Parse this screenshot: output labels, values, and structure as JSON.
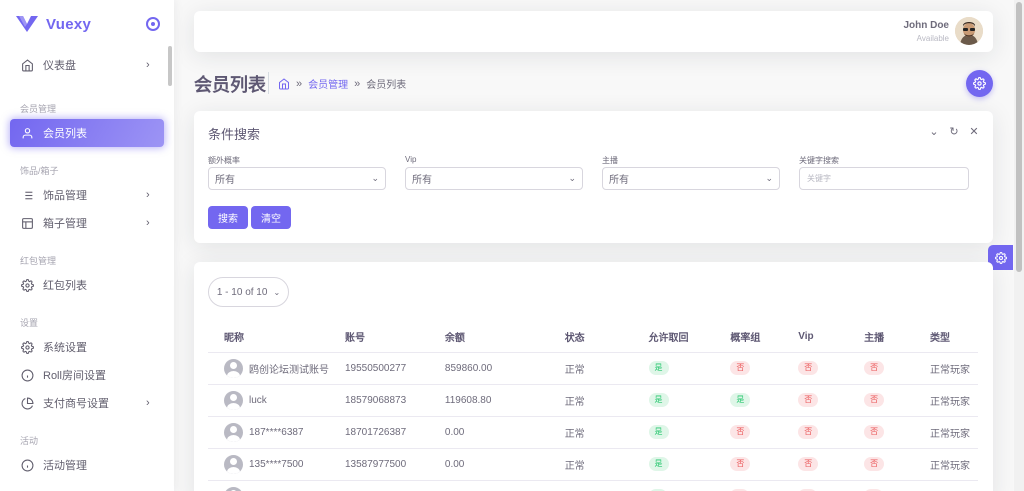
{
  "brand": {
    "name": "Vuexy",
    "color": "#7367f0"
  },
  "sidebar": {
    "dashboard": {
      "label": "仪表盘",
      "icon": "home-icon"
    },
    "sections": [
      {
        "header": "会员管理"
      },
      {
        "header": "饰品/箱子"
      },
      {
        "header": "红包管理"
      },
      {
        "header": "设置"
      },
      {
        "header": "活动"
      }
    ],
    "items": {
      "members": {
        "label": "会员列表",
        "icon": "user-icon",
        "active": true
      },
      "items_mgmt": {
        "label": "饰品管理",
        "icon": "list-icon"
      },
      "box_mgmt": {
        "label": "箱子管理",
        "icon": "layout-icon"
      },
      "redpacket_list": {
        "label": "红包列表",
        "icon": "settings-icon"
      },
      "system_settings": {
        "label": "系统设置",
        "icon": "settings-icon"
      },
      "roll_settings": {
        "label": "Roll房间设置",
        "icon": "info-icon"
      },
      "payment_settings": {
        "label": "支付商号设置",
        "icon": "pie-chart-icon"
      },
      "activity_mgmt": {
        "label": "活动管理",
        "icon": "info-icon"
      }
    }
  },
  "navbar": {
    "user_name": "John Doe",
    "user_status": "Available"
  },
  "page": {
    "title": "会员列表",
    "breadcrumb": {
      "link": "会员管理",
      "current": "会员列表",
      "separator": "»"
    }
  },
  "filter": {
    "title": "条件搜索",
    "fields": {
      "extra_prob": {
        "label": "额外概率",
        "value": "所有"
      },
      "vip": {
        "label": "Vip",
        "value": "所有"
      },
      "anchor": {
        "label": "主播",
        "value": "所有"
      },
      "keyword": {
        "label": "关键字搜索",
        "placeholder": "关键字"
      }
    },
    "search_button": "搜索",
    "clear_button": "清空"
  },
  "table": {
    "pager_label": "1 - 10 of 10",
    "columns": [
      "昵称",
      "账号",
      "余额",
      "状态",
      "允许取回",
      "概率组",
      "Vip",
      "主播",
      "类型"
    ],
    "rows": [
      {
        "nickname": "鸥创论坛测试账号",
        "account": "19550500277",
        "balance": "859860.00",
        "status": "正常",
        "allow_withdraw": "是",
        "prob_group": "否",
        "vip": "否",
        "anchor": "否",
        "type": "正常玩家"
      },
      {
        "nickname": "luck",
        "account": "18579068873",
        "balance": "119608.80",
        "status": "正常",
        "allow_withdraw": "是",
        "prob_group": "是",
        "vip": "否",
        "anchor": "否",
        "type": "正常玩家"
      },
      {
        "nickname": "187****6387",
        "account": "18701726387",
        "balance": "0.00",
        "status": "正常",
        "allow_withdraw": "是",
        "prob_group": "否",
        "vip": "否",
        "anchor": "否",
        "type": "正常玩家"
      },
      {
        "nickname": "135****7500",
        "account": "13587977500",
        "balance": "0.00",
        "status": "正常",
        "allow_withdraw": "是",
        "prob_group": "否",
        "vip": "否",
        "anchor": "否",
        "type": "正常玩家"
      }
    ]
  },
  "colors": {
    "primary": "#7367f0",
    "success": "#28c76f",
    "danger": "#ea5455"
  }
}
